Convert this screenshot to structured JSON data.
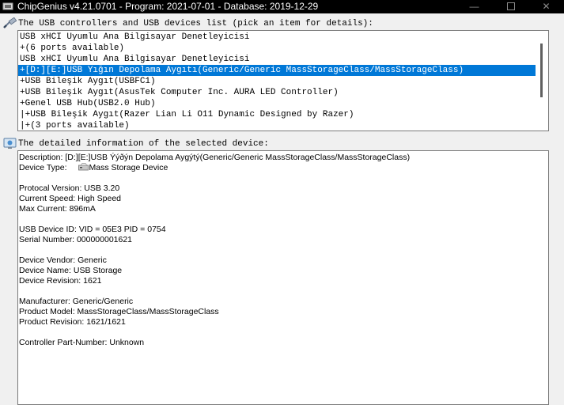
{
  "window": {
    "title": "ChipGenius v4.21.0701 - Program: 2021-07-01 - Database: 2019-12-29",
    "minimize_glyph": "—",
    "close_glyph": "✕"
  },
  "devices_section": {
    "label": "The USB controllers and USB devices list (pick an item for details):",
    "items": [
      {
        "text": "USB xHCI Uyumlu Ana Bilgisayar Denetleyicisi",
        "selected": false
      },
      {
        "text": "+(6 ports available)",
        "selected": false
      },
      {
        "text": "USB xHCI Uyumlu Ana Bilgisayar Denetleyicisi",
        "selected": false
      },
      {
        "text": "+[D:][E:]USB Yığın Depolama Aygıtı(Generic/Generic MassStorageClass/MassStorageClass)",
        "selected": true
      },
      {
        "text": "+USB Bileşik Aygıt(USBFC1)",
        "selected": false
      },
      {
        "text": "+USB Bileşik Aygıt(AsusTek Computer Inc. AURA LED Controller)",
        "selected": false
      },
      {
        "text": "+Genel USB Hub(USB2.0 Hub)",
        "selected": false
      },
      {
        "text": "|+USB Bileşik Aygıt(Razer Lian Li O11 Dynamic Designed by Razer)",
        "selected": false
      },
      {
        "text": "|+(3 ports available)",
        "selected": false
      }
    ]
  },
  "details_section": {
    "label": "The detailed information of the selected device:",
    "lines": [
      "Description: [D:][E:]USB Ýýðýn Depolama Aygýtý(Generic/Generic MassStorageClass/MassStorageClass)",
      "Device Type:     Mass Storage Device",
      "",
      "Protocal Version: USB 3.20",
      "Current Speed: High Speed",
      "Max Current: 896mA",
      "",
      "USB Device ID: VID = 05E3 PID = 0754",
      "Serial Number: 000000001621",
      "",
      "Device Vendor: Generic",
      "Device Name: USB Storage",
      "Device Revision: 1621",
      "",
      "Manufacturer: Generic/Generic",
      "Product Model: MassStorageClass/MassStorageClass",
      "Product Revision: 1621/1621",
      "",
      "Controller Part-Number: Unknown"
    ],
    "device_type_label": "Device Type:",
    "device_type_value": "Mass Storage Device"
  },
  "colors": {
    "selection": "#0078d7",
    "titlebar": "#000000"
  }
}
